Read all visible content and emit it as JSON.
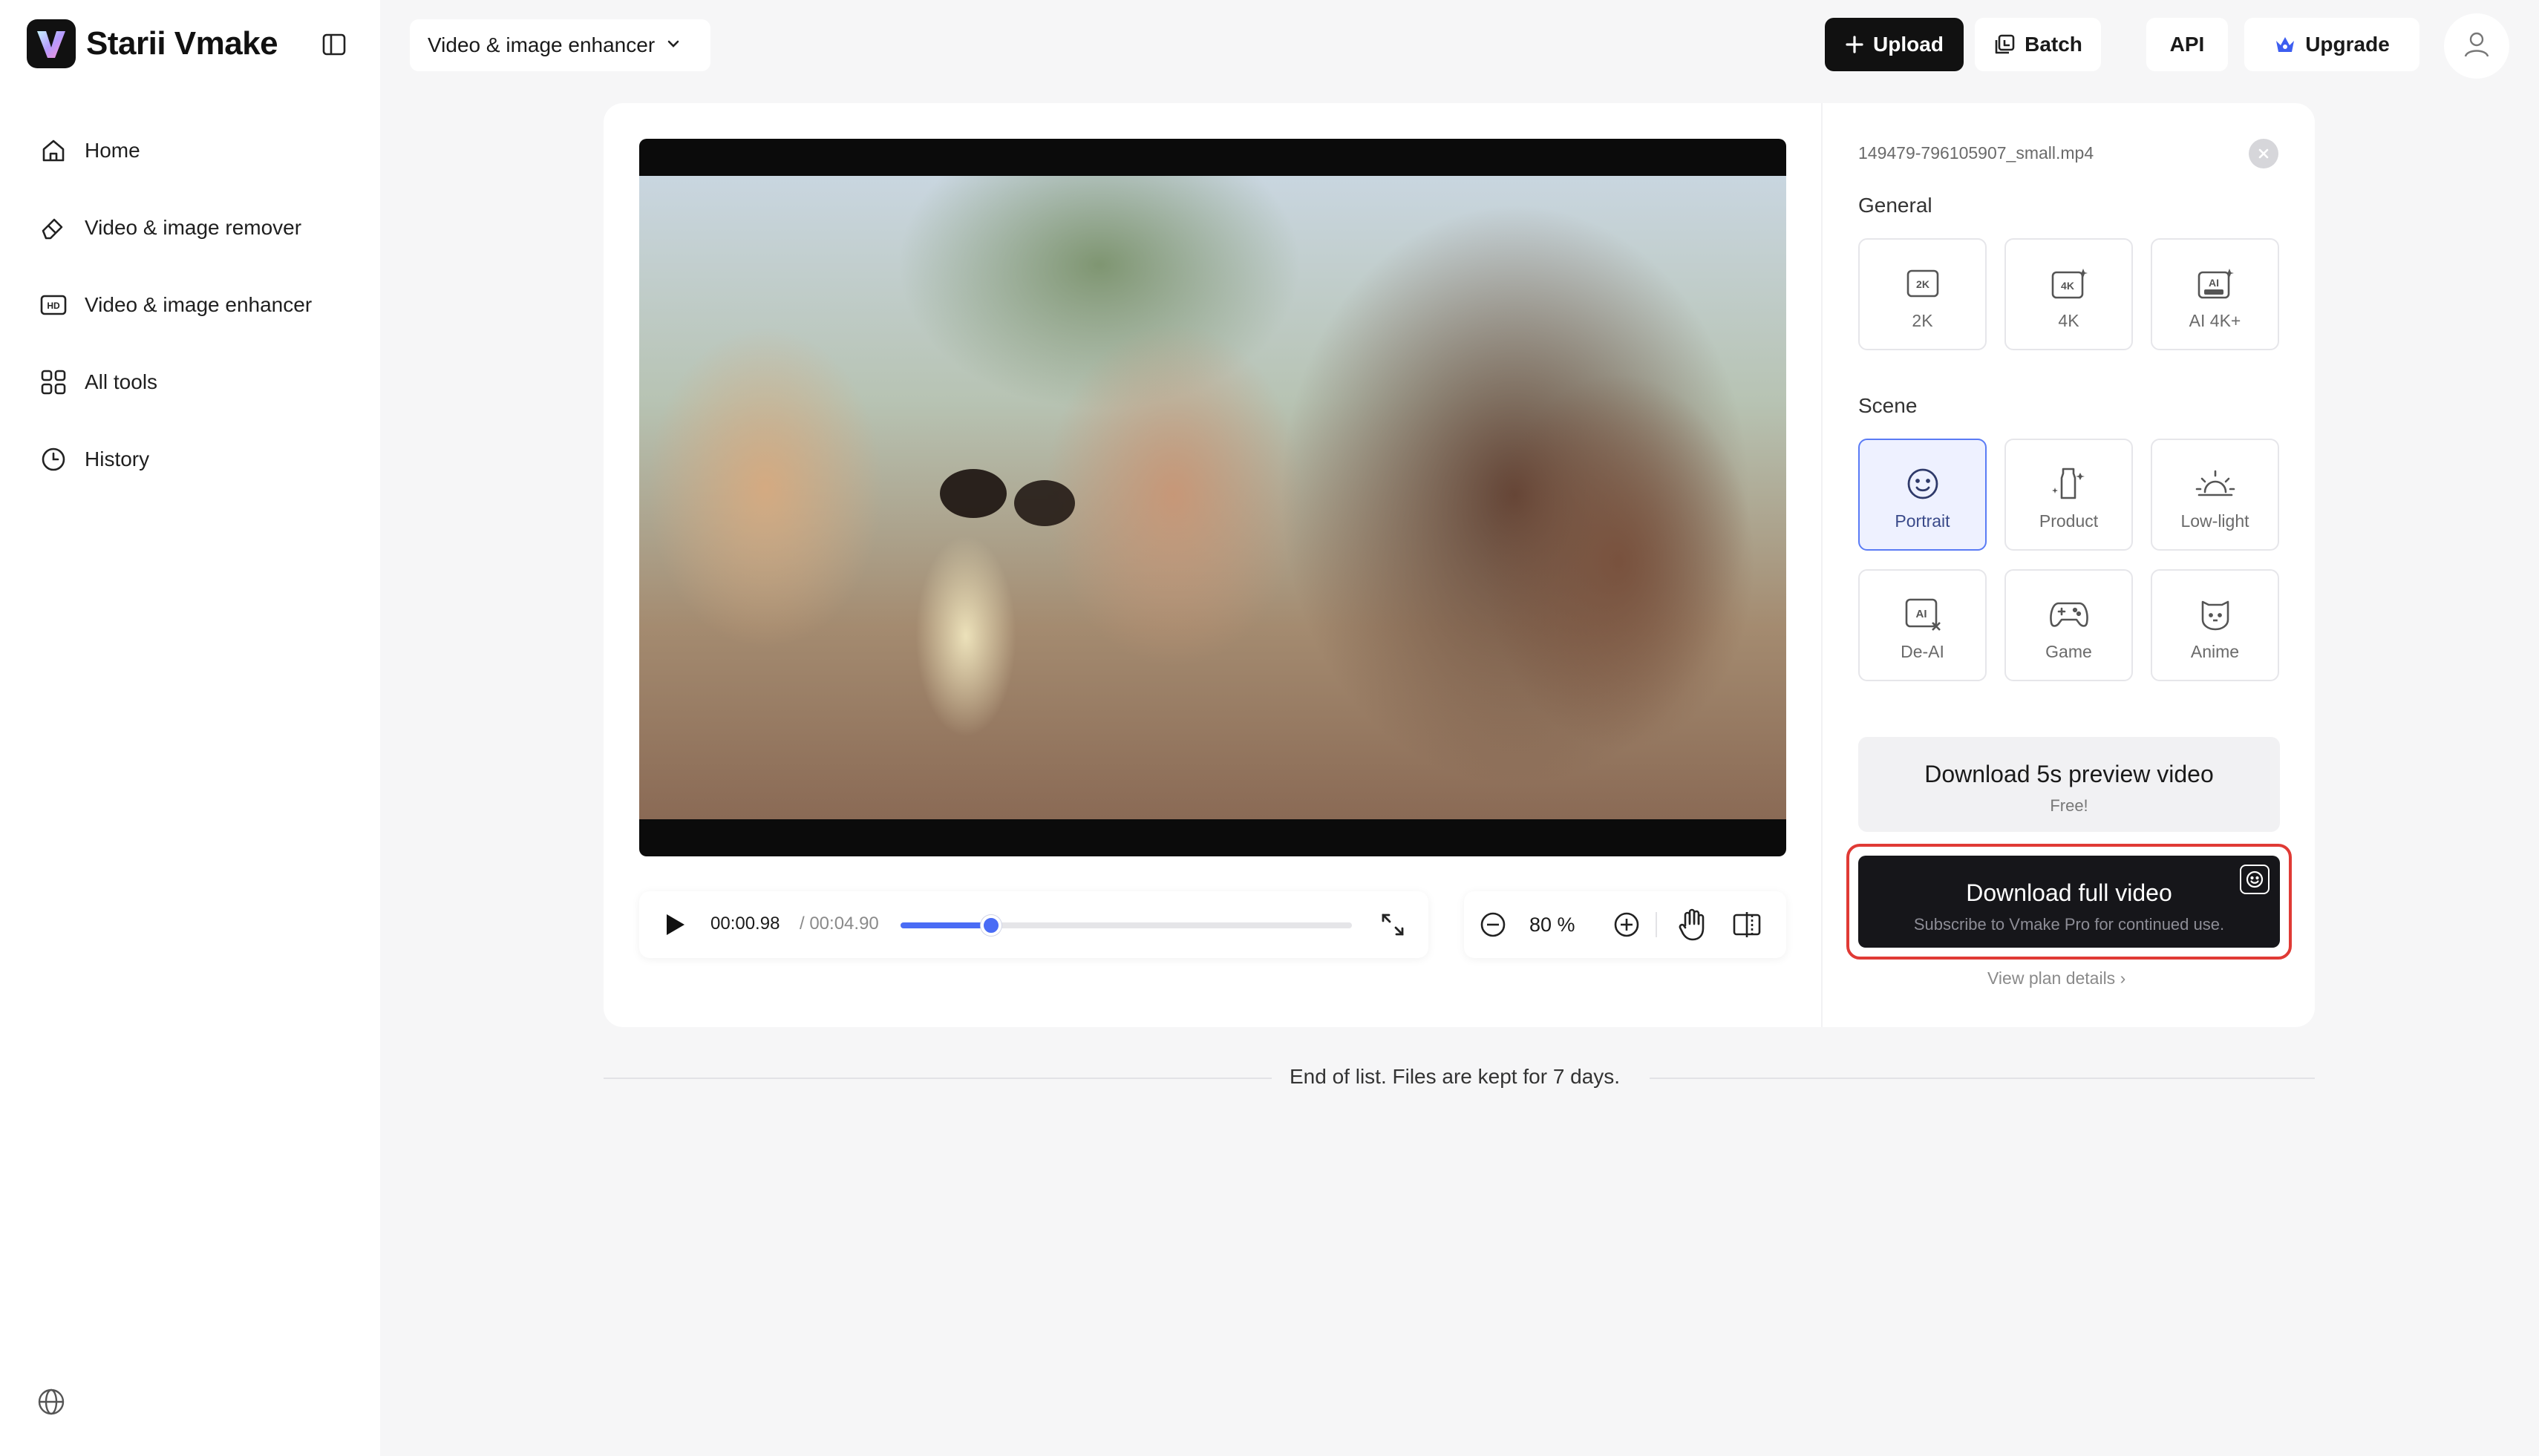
{
  "app": {
    "name": "Starii Vmake"
  },
  "sidebar": {
    "items": [
      {
        "label": "Home",
        "icon": "home-icon"
      },
      {
        "label": "Video & image remover",
        "icon": "eraser-icon"
      },
      {
        "label": "Video & image enhancer",
        "icon": "hd-icon"
      },
      {
        "label": "All tools",
        "icon": "grid-icon"
      },
      {
        "label": "History",
        "icon": "clock-icon"
      }
    ]
  },
  "topbar": {
    "tool_select": "Video & image enhancer",
    "upload": "Upload",
    "batch": "Batch",
    "api": "API",
    "upgrade": "Upgrade"
  },
  "player": {
    "current_time": "00:00.98",
    "total_time": "/ 00:04.90",
    "progress": 0.2,
    "zoom": "80 %"
  },
  "panel": {
    "filename": "149479-796105907_small.mp4",
    "general_label": "General",
    "general_options": [
      "2K",
      "4K",
      "AI 4K+"
    ],
    "scene_label": "Scene",
    "scene_options": [
      "Portrait",
      "Product",
      "Low-light",
      "De-AI",
      "Game",
      "Anime"
    ],
    "selected_scene": "Portrait",
    "preview_title": "Download 5s preview video",
    "preview_sub": "Free!",
    "full_title": "Download full video",
    "full_sub": "Subscribe to Vmake Pro for continued use.",
    "plan_link": "View plan details ›"
  },
  "footer": {
    "end_text": "End of list. Files are kept for 7 days."
  },
  "colors": {
    "accent": "#4a6cf5",
    "highlight": "#e03a35",
    "dark": "#16161a"
  }
}
